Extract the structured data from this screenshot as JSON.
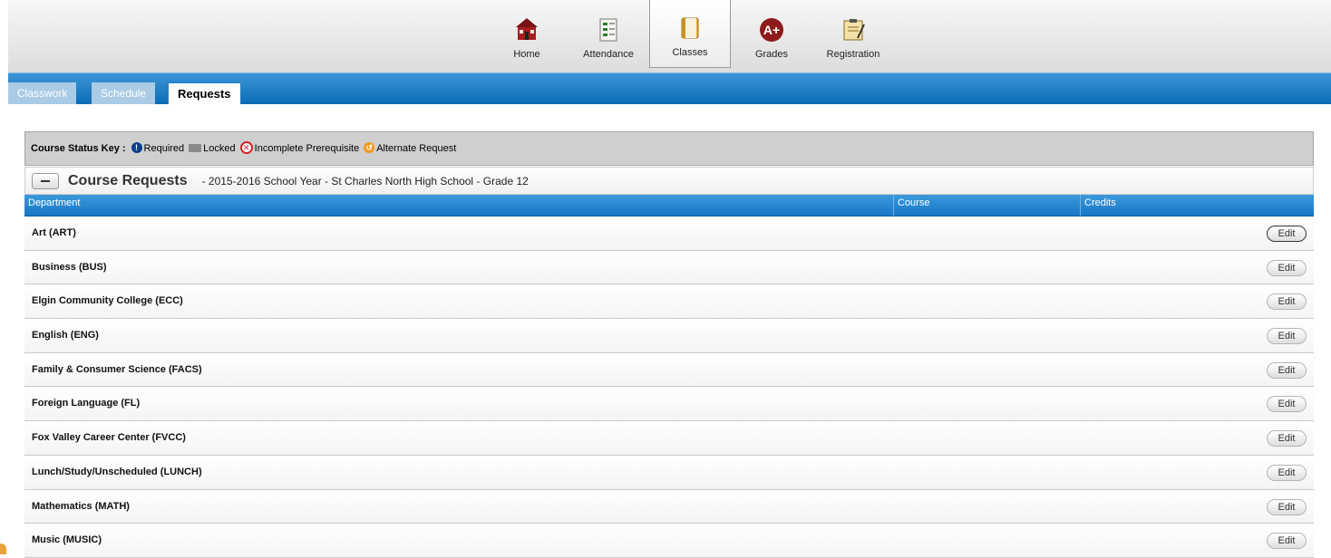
{
  "topnav": {
    "items": [
      {
        "label": "Home",
        "icon": "schoolhouse-icon",
        "active": false
      },
      {
        "label": "Attendance",
        "icon": "attendance-checklist-icon",
        "active": false
      },
      {
        "label": "Classes",
        "icon": "classes-book-icon",
        "active": true
      },
      {
        "label": "Grades",
        "icon": "grades-a-plus-icon",
        "active": false
      },
      {
        "label": "Registration",
        "icon": "registration-clipboard-icon",
        "active": false
      }
    ]
  },
  "tabs": [
    {
      "label": "Classwork",
      "active": false
    },
    {
      "label": "Schedule",
      "active": false
    },
    {
      "label": "Requests",
      "active": true
    }
  ],
  "status_key": {
    "title": "Course Status Key :",
    "items": [
      {
        "label": "Required",
        "icon": "required-icon"
      },
      {
        "label": "Locked",
        "icon": "locked-icon"
      },
      {
        "label": "Incomplete Prerequisite",
        "icon": "incomplete-icon"
      },
      {
        "label": "Alternate Request",
        "icon": "alternate-icon"
      }
    ]
  },
  "course_requests": {
    "title": "Course Requests",
    "subtitle": "- 2015-2016 School Year - St Charles North High School - Grade 12",
    "columns": [
      "Department",
      "Course",
      "Credits"
    ],
    "edit_label": "Edit",
    "rows": [
      "Art (ART)",
      "Business (BUS)",
      "Elgin Community College (ECC)",
      "English (ENG)",
      "Family & Consumer Science (FACS)",
      "Foreign Language (FL)",
      "Fox Valley Career Center (FVCC)",
      "Lunch/Study/Unscheduled (LUNCH)",
      "Mathematics (MATH)",
      "Music (MUSIC)"
    ]
  },
  "colors": {
    "tab_bar": "#0a6db6",
    "header_blue": "#1877c6",
    "status_key_bg": "#cfcfcf",
    "alternate_orange": "#f09a1c"
  }
}
